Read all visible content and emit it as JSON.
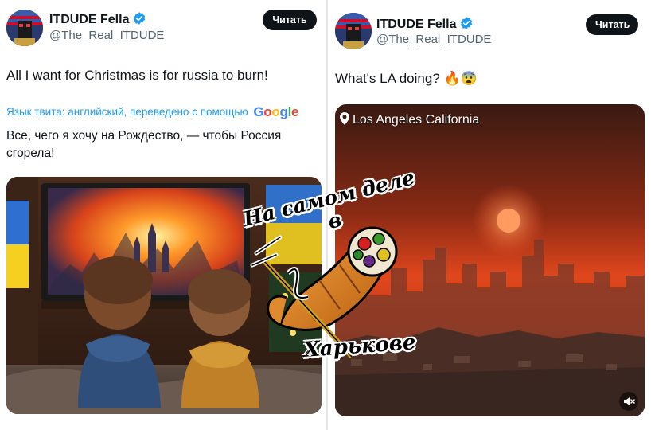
{
  "left_tweet": {
    "author_name": "ITDUDE Fella",
    "handle": "@The_Real_ITDUDE",
    "follow_label": "Читать",
    "text": "All I want for Christmas is for russia to burn!",
    "translation_notice": "Язык твита: английский, переведено с помощью",
    "translation_provider": "Google",
    "translation_line1": "Все, чего я хочу на Рождество, — чтобы Россия",
    "translation_line2": "сгорела!"
  },
  "right_tweet": {
    "author_name": "ITDUDE Fella",
    "handle": "@The_Real_ITDUDE",
    "follow_label": "Читать",
    "text": "What's LA doing? 🔥😨",
    "location_label": "Los Angeles California"
  },
  "watermark": {
    "line1": "На самом деле в",
    "line2": "Харькове"
  },
  "icons": {
    "verified": "verified-badge-icon",
    "location": "location-pin-icon",
    "mute": "speaker-mute-icon"
  },
  "colors": {
    "link": "#1d9bf0",
    "button": "#0f1419",
    "secondary_text": "#536471"
  }
}
